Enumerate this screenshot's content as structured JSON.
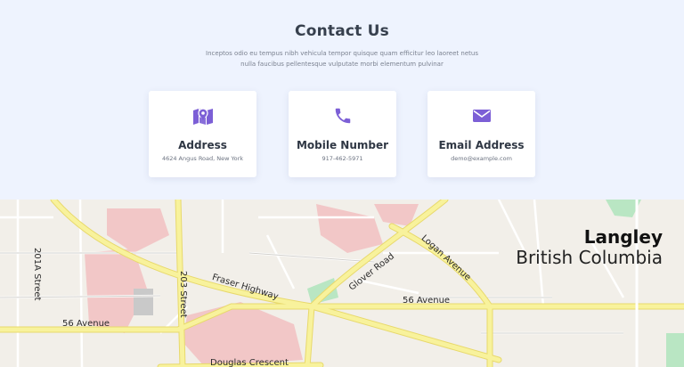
{
  "section": {
    "title": "Contact Us",
    "description": "Inceptos odio eu tempus nibh vehicula tempor quisque quam efficitur leo laoreet netus nulla faucibus pellentesque vulputate morbi elementum pulvinar"
  },
  "cards": [
    {
      "icon": "map-icon",
      "title": "Address",
      "value": "4624 Angus Road, New York"
    },
    {
      "icon": "phone-icon",
      "title": "Mobile Number",
      "value": "917-462-5971"
    },
    {
      "icon": "envelope-icon",
      "title": "Email Address",
      "value": "demo@example.com"
    }
  ],
  "map": {
    "city": "Langley",
    "region": "British Columbia",
    "streets": {
      "s201a": "201A Street",
      "s203": "203 Street",
      "fraser": "Fraser Highway",
      "glover": "Glover Road",
      "logan": "Logan Avenue",
      "ave56_right": "56 Avenue",
      "ave56_left": "56 Avenue",
      "douglas": "Douglas Crescent"
    }
  },
  "colors": {
    "accent": "#7c5fd6",
    "background": "#eef3fe",
    "card": "#ffffff",
    "title": "#37404e"
  }
}
